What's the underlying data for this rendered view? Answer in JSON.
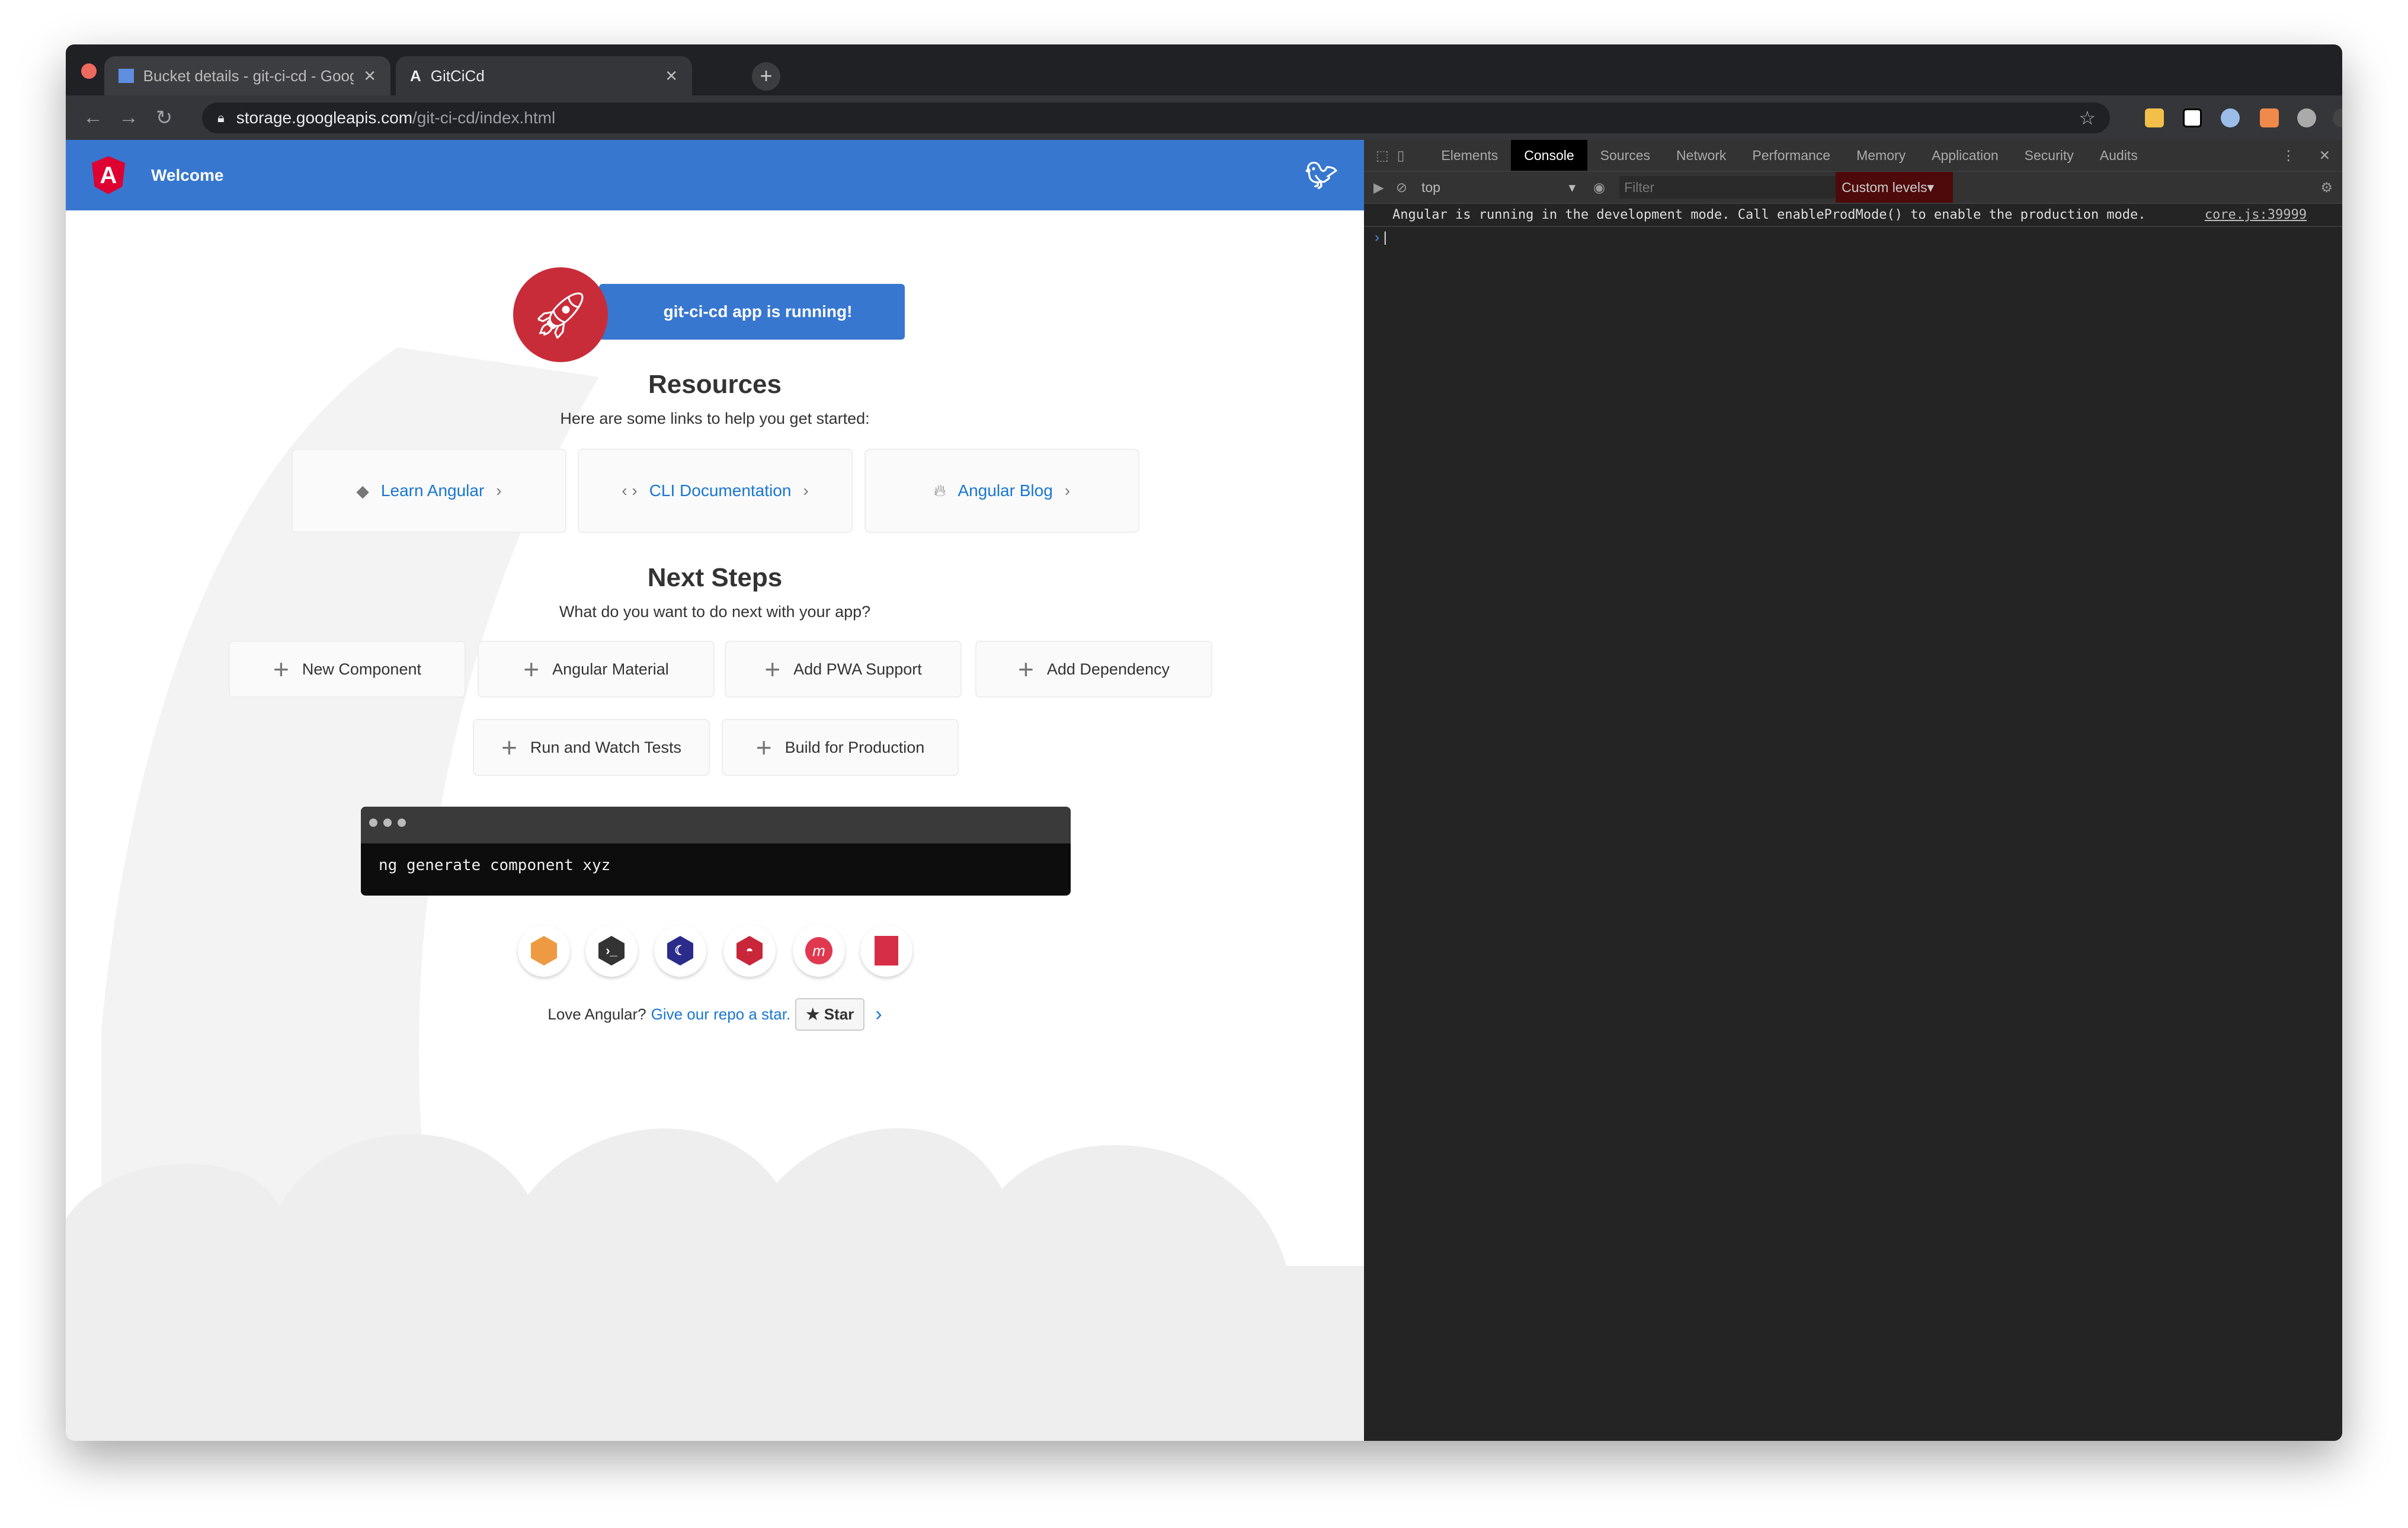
{
  "browser": {
    "tabs": [
      {
        "title": "Bucket details - git-ci-cd - Goog",
        "icon": "google-cloud-storage-icon",
        "active": false
      },
      {
        "title": "GitCiCd",
        "icon": "angular-icon",
        "active": true
      }
    ],
    "url_host": "storage.googleapis.com",
    "url_path": "/git-ci-cd/index.html",
    "extensions": [
      "star-icon",
      "lastpass-icon",
      "notion-icon",
      "lightbulbs-icon",
      "color-picker-icon",
      "gear-icon",
      "bee-icon",
      "profile-avatar",
      "update-icon"
    ]
  },
  "app": {
    "header_title": "Welcome",
    "banner": "git-ci-cd app is running!",
    "resources_title": "Resources",
    "resources_subtitle": "Here are some links to help you get started:",
    "resources": [
      {
        "label": "Learn Angular",
        "icon": "graduation-cap-icon"
      },
      {
        "label": "CLI Documentation",
        "icon": "code-brackets-icon"
      },
      {
        "label": "Angular Blog",
        "icon": "flame-icon"
      }
    ],
    "next_title": "Next Steps",
    "next_subtitle": "What do you want to do next with your app?",
    "steps": [
      "New Component",
      "Angular Material",
      "Add PWA Support",
      "Add Dependency",
      "Run and Watch Tests",
      "Build for Production"
    ],
    "terminal_command": "ng generate component xyz",
    "partner_icons": [
      "ngrx-icon",
      "angular-console-icon",
      "augury-icon",
      "protractor-icon",
      "meetup-icon",
      "gitter-icon"
    ],
    "love_text": "Love Angular?",
    "love_link": "Give our repo a star.",
    "star_label": "Star",
    "colors": {
      "primary": "#3777cf",
      "rocket": "#c92c39"
    }
  },
  "devtools": {
    "tabs": [
      "Elements",
      "Console",
      "Sources",
      "Network",
      "Performance",
      "Memory",
      "Application",
      "Security",
      "Audits"
    ],
    "active_tab": "Console",
    "context": "top",
    "filter_placeholder": "Filter",
    "levels": "Custom levels",
    "messages": [
      {
        "text": "Angular is running in the development mode. Call enableProdMode() to enable the production mode.",
        "source": "core.js:39999"
      }
    ],
    "prompt": "›"
  }
}
